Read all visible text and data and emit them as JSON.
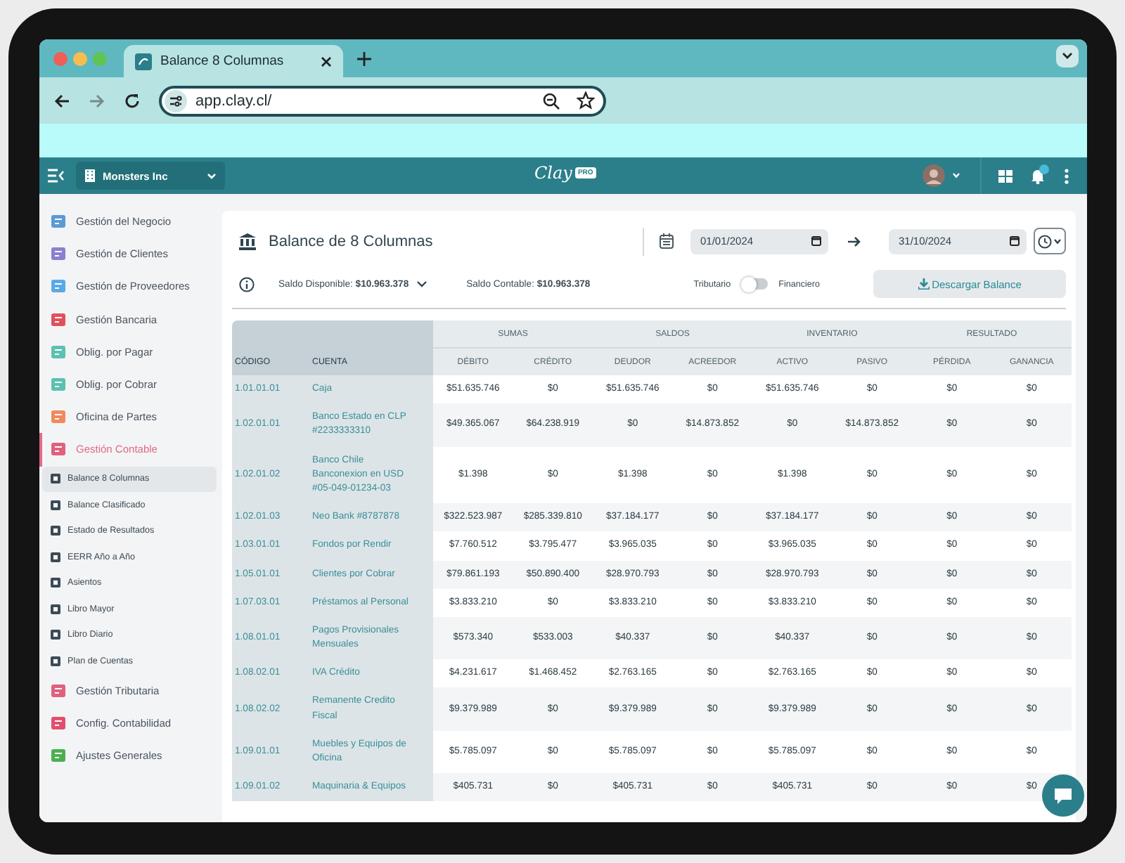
{
  "browser": {
    "tab_title": "Balance 8 Columnas",
    "url": "app.clay.cl/"
  },
  "app_header": {
    "company": "Monsters Inc",
    "logo": "Clay",
    "logo_badge": "PRO"
  },
  "sidebar": {
    "items": [
      {
        "label": "Gestión del Negocio",
        "color": "#5b9bd5",
        "selected": false
      },
      {
        "label": "Gestión de Clientes",
        "color": "#8a7fd0",
        "selected": false
      },
      {
        "label": "Gestión de Proveedores",
        "color": "#5aa9e6",
        "selected": false
      },
      {
        "label": "Gestión Bancaria",
        "color": "#e0525b",
        "selected": false
      },
      {
        "label": "Oblig. por Pagar",
        "color": "#5cc1b0",
        "selected": false
      },
      {
        "label": "Oblig. por Cobrar",
        "color": "#5cc1b0",
        "selected": false
      },
      {
        "label": "Oficina de Partes",
        "color": "#f08a5d",
        "selected": false
      },
      {
        "label": "Gestión Contable",
        "color": "#e0607e",
        "selected": true,
        "children": [
          {
            "label": "Balance 8 Columnas",
            "selected": true
          },
          {
            "label": "Balance Clasificado",
            "selected": false
          },
          {
            "label": "Estado de Resultados",
            "selected": false
          },
          {
            "label": "EERR Año a Año",
            "selected": false
          },
          {
            "label": "Asientos",
            "selected": false
          },
          {
            "label": "Libro Mayor",
            "selected": false
          },
          {
            "label": "Libro Diario",
            "selected": false
          },
          {
            "label": "Plan de Cuentas",
            "selected": false
          }
        ]
      },
      {
        "label": "Gestión Tributaria",
        "color": "#e0607e",
        "selected": false
      },
      {
        "label": "Config. Contabilidad",
        "color": "#e0506e",
        "selected": false
      },
      {
        "label": "Ajustes Generales",
        "color": "#4cb050",
        "selected": false
      }
    ]
  },
  "page": {
    "title": "Balance de 8 Columnas",
    "date_from": "01/01/2024",
    "date_to": "31/10/2024",
    "saldo_disponible": "Saldo Disponible: **$10.963.378**",
    "saldo_contable": "Saldo Contable: **$10.963.378**",
    "toggle": {
      "left_label": "Tributario",
      "right_label": "Financiero",
      "on": false
    },
    "download_button": "Descargar Balance"
  },
  "table": {
    "fixed_columns": [
      "CÓDIGO",
      "CUENTA"
    ],
    "groups": [
      {
        "label": "SUMAS",
        "columns": [
          "DÉBITO",
          "CRÉDITO"
        ]
      },
      {
        "label": "SALDOS",
        "columns": [
          "DEUDOR",
          "ACREEDOR"
        ]
      },
      {
        "label": "INVENTARIO",
        "columns": [
          "ACTIVO",
          "PASIVO"
        ]
      },
      {
        "label": "RESULTADO",
        "columns": [
          "PÉRDIDA",
          "GANANCIA"
        ]
      }
    ],
    "rows": [
      {
        "code": "1.01.01.01",
        "account": "Caja",
        "values": [
          "$51.635.746",
          "$0",
          "$51.635.746",
          "$0",
          "$51.635.746",
          "$0",
          "$0",
          "$0"
        ]
      },
      {
        "code": "1.02.01.01",
        "account": "Banco Estado en CLP #2233333310",
        "values": [
          "$49.365.067",
          "$64.238.919",
          "$0",
          "$14.873.852",
          "$0",
          "$14.873.852",
          "$0",
          "$0"
        ]
      },
      {
        "code": "1.02.01.02",
        "account": "Banco Chile Banconexion en USD #05-049-01234-03",
        "values": [
          "$1.398",
          "$0",
          "$1.398",
          "$0",
          "$1.398",
          "$0",
          "$0",
          "$0"
        ]
      },
      {
        "code": "1.02.01.03",
        "account": "Neo Bank #8787878",
        "values": [
          "$322.523.987",
          "$285.339.810",
          "$37.184.177",
          "$0",
          "$37.184.177",
          "$0",
          "$0",
          "$0"
        ]
      },
      {
        "code": "1.03.01.01",
        "account": "Fondos por Rendir",
        "values": [
          "$7.760.512",
          "$3.795.477",
          "$3.965.035",
          "$0",
          "$3.965.035",
          "$0",
          "$0",
          "$0"
        ]
      },
      {
        "code": "1.05.01.01",
        "account": "Clientes por Cobrar",
        "values": [
          "$79.861.193",
          "$50.890.400",
          "$28.970.793",
          "$0",
          "$28.970.793",
          "$0",
          "$0",
          "$0"
        ]
      },
      {
        "code": "1.07.03.01",
        "account": "Préstamos al Personal",
        "values": [
          "$3.833.210",
          "$0",
          "$3.833.210",
          "$0",
          "$3.833.210",
          "$0",
          "$0",
          "$0"
        ]
      },
      {
        "code": "1.08.01.01",
        "account": "Pagos Provisionales Mensuales",
        "values": [
          "$573.340",
          "$533.003",
          "$40.337",
          "$0",
          "$40.337",
          "$0",
          "$0",
          "$0"
        ]
      },
      {
        "code": "1.08.02.01",
        "account": "IVA Crédito",
        "values": [
          "$4.231.617",
          "$1.468.452",
          "$2.763.165",
          "$0",
          "$2.763.165",
          "$0",
          "$0",
          "$0"
        ]
      },
      {
        "code": "1.08.02.02",
        "account": "Remanente Credito Fiscal",
        "values": [
          "$9.379.989",
          "$0",
          "$9.379.989",
          "$0",
          "$9.379.989",
          "$0",
          "$0",
          "$0"
        ]
      },
      {
        "code": "1.09.01.01",
        "account": "Muebles y Equipos de Oficina",
        "values": [
          "$5.785.097",
          "$0",
          "$5.785.097",
          "$0",
          "$5.785.097",
          "$0",
          "$0",
          "$0"
        ]
      },
      {
        "code": "1.09.01.02",
        "account": "Maquinaria & Equipos",
        "values": [
          "$405.731",
          "$0",
          "$405.731",
          "$0",
          "$405.731",
          "$0",
          "$0",
          "$0"
        ]
      }
    ]
  }
}
